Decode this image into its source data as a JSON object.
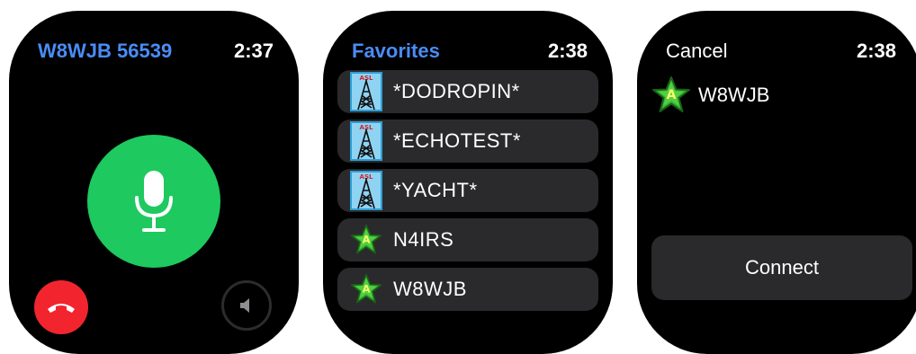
{
  "screens": [
    {
      "title": "W8WJB 56539",
      "time": "2:37",
      "mic_icon": "microphone-icon",
      "hangup_icon": "phone-hangup-icon",
      "speaker_icon": "speaker-icon",
      "colors": {
        "title": "#4a8cf7",
        "mic": "#1ec95f",
        "hangup": "#f2252f"
      }
    },
    {
      "title": "Favorites",
      "time": "2:38",
      "items": [
        {
          "label": "*DODROPIN*",
          "icon": "radio-tower-icon"
        },
        {
          "label": "*ECHOTEST*",
          "icon": "radio-tower-icon"
        },
        {
          "label": "*YACHT*",
          "icon": "radio-tower-icon"
        },
        {
          "label": "N4IRS",
          "icon": "green-star-icon"
        },
        {
          "label": "W8WJB",
          "icon": "green-star-icon"
        }
      ]
    },
    {
      "title": "Cancel",
      "time": "2:38",
      "node_label": "W8WJB",
      "node_icon": "green-star-icon",
      "connect_label": "Connect"
    }
  ]
}
